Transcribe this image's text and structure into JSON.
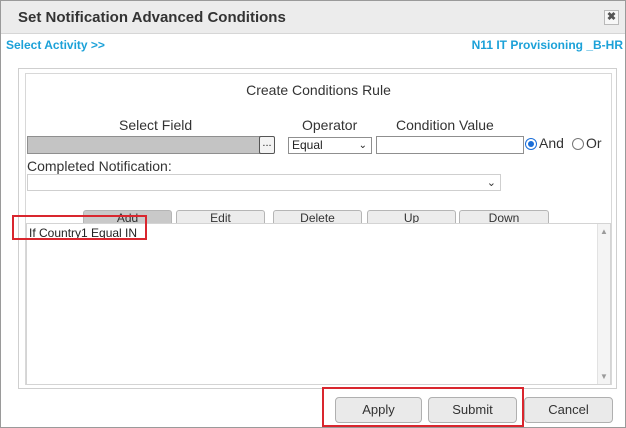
{
  "dialog": {
    "title": "Set Notification Advanced Conditions",
    "close_glyph": "✖"
  },
  "header": {
    "select_activity": "Select Activity >>",
    "activity_name": "N11 IT Provisioning _B-HR"
  },
  "panel": {
    "title": "Create Conditions Rule",
    "select_field_label": "Select Field",
    "operator_label": "Operator",
    "condition_value_label": "Condition Value",
    "field_value": "",
    "ellipsis": "...",
    "operator_value": "Equal",
    "condition_value": "",
    "logic_and": "And",
    "logic_or": "Or",
    "logic_selected": "And",
    "completed_label": "Completed Notification:",
    "completed_value": ""
  },
  "actions": {
    "add": "Add",
    "edit": "Edit",
    "delete": "Delete",
    "up": "Up",
    "down": "Down"
  },
  "rules": [
    "If Country1 Equal IN"
  ],
  "footer": {
    "apply": "Apply",
    "submit": "Submit",
    "cancel": "Cancel"
  },
  "colors": {
    "accent_link": "#1ba1d8",
    "highlight": "#d9262e",
    "radio_selected": "#1a6ed8"
  }
}
